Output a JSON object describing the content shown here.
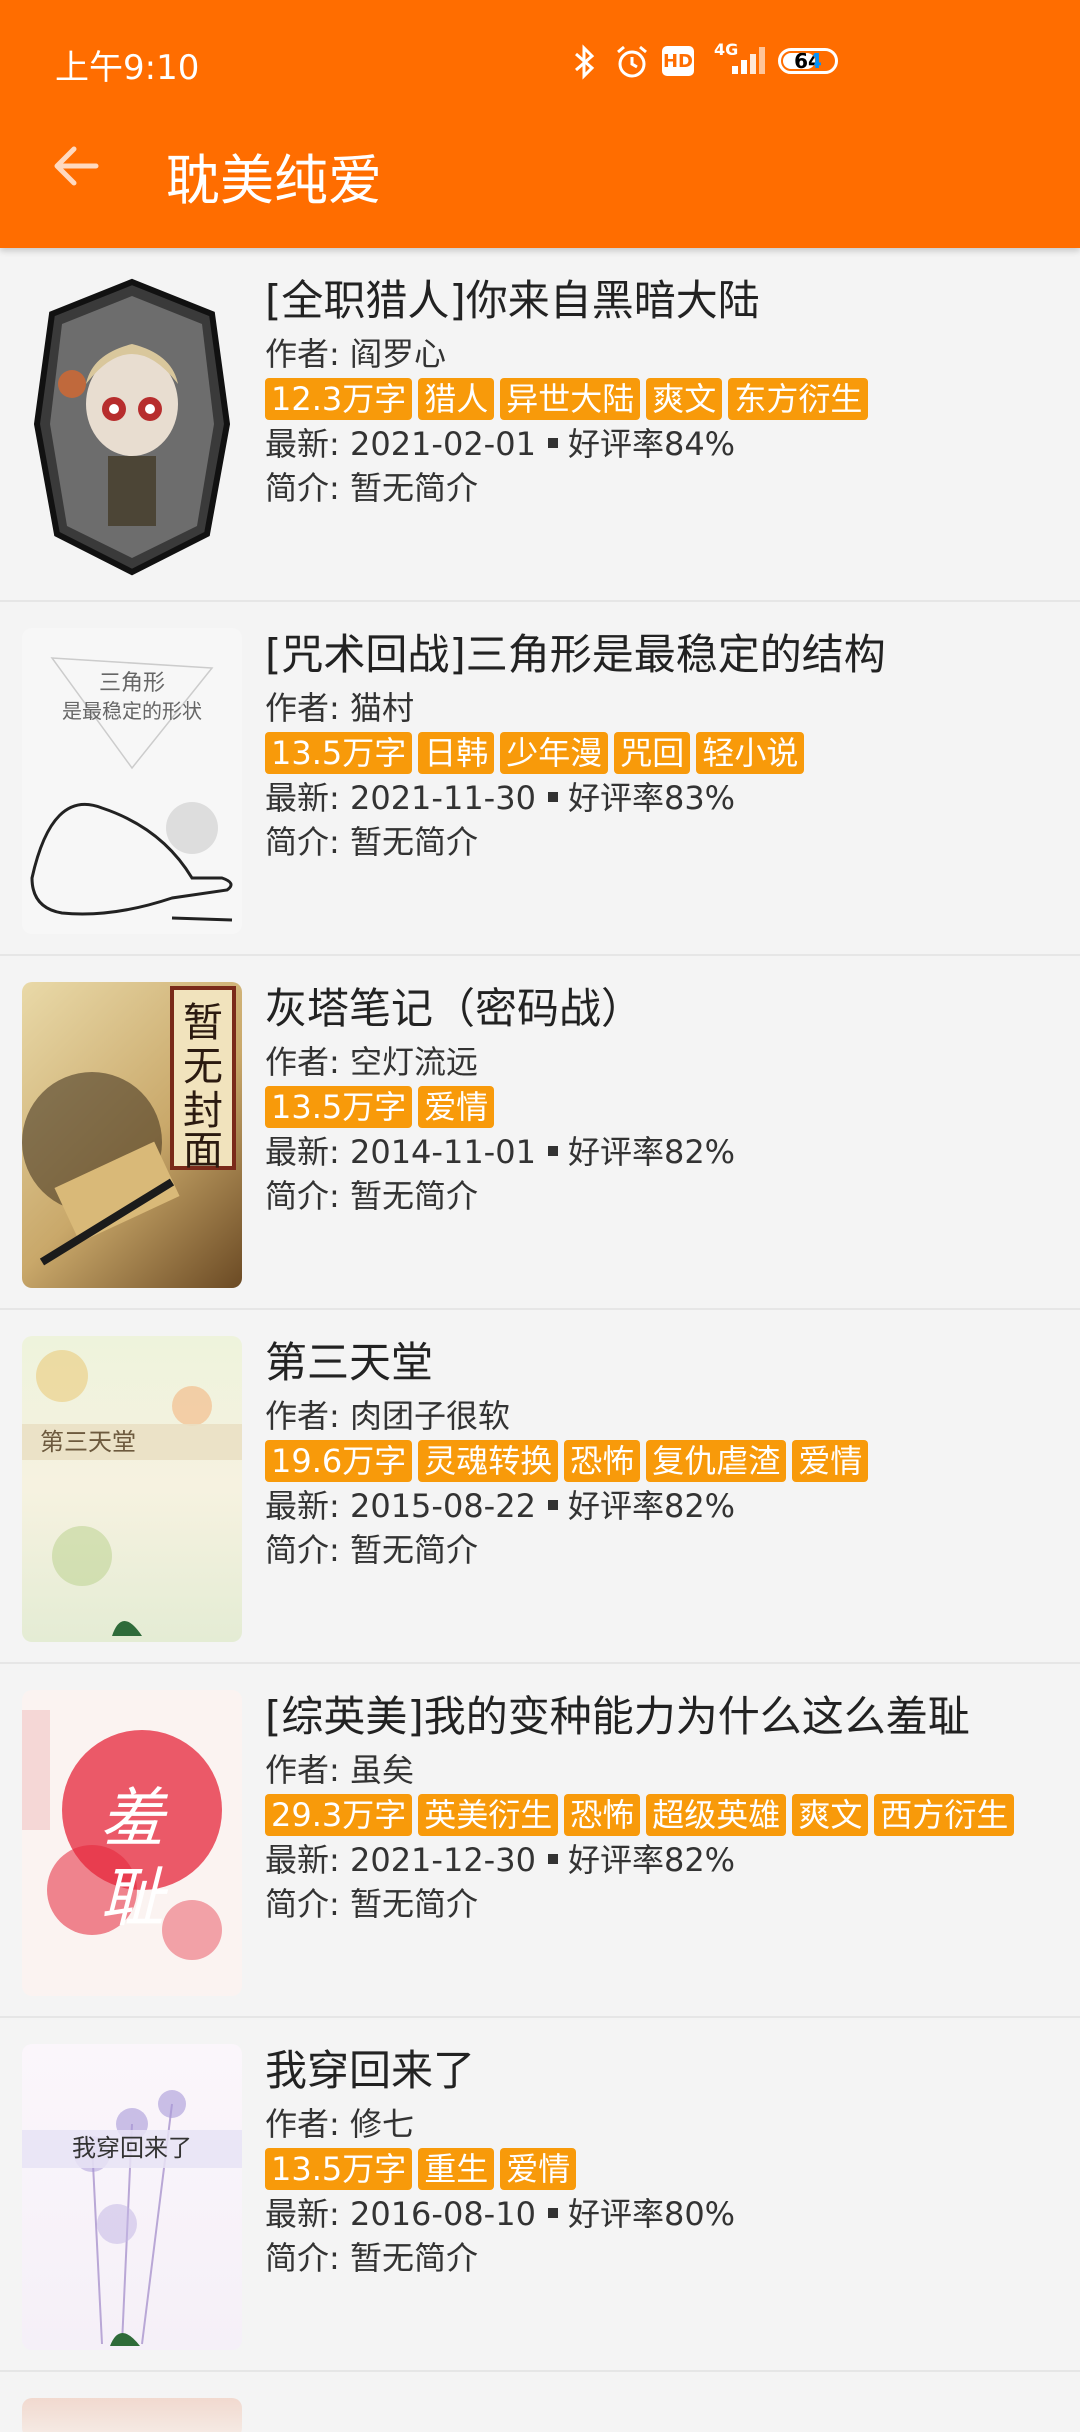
{
  "status_bar": {
    "time": "上午9:10",
    "network": "4G",
    "battery": "64",
    "icons": [
      "bluetooth-icon",
      "alarm-icon",
      "hd-icon",
      "signal-icon",
      "battery-icon"
    ]
  },
  "app_bar": {
    "title": "耽美纯爱",
    "back_icon": "arrow-left-icon",
    "color": "#ff6d00"
  },
  "labels": {
    "author_prefix": "作者: ",
    "latest_prefix": "最新: ",
    "rating_prefix": "好评率",
    "intro_prefix": "简介: "
  },
  "books": [
    {
      "title": "[全职猎人]你来自黑暗大陆",
      "author": "阎罗心",
      "tags": [
        "12.3万字",
        "猎人",
        "异世大陆",
        "爽文",
        "东方衍生"
      ],
      "date": "2021-02-01",
      "rating": "84%",
      "intro": "暂无简介",
      "cover_text": ""
    },
    {
      "title": "[咒术回战]三角形是最稳定的结构",
      "author": "猫村",
      "tags": [
        "13.5万字",
        "日韩",
        "少年漫",
        "咒回",
        "轻小说"
      ],
      "date": "2021-11-30",
      "rating": "83%",
      "intro": "暂无简介",
      "cover_text": "三角形\n是最稳定的形状"
    },
    {
      "title": "灰塔笔记（密码战）",
      "author": "空灯流远",
      "tags": [
        "13.5万字",
        "爱情"
      ],
      "date": "2014-11-01",
      "rating": "82%",
      "intro": "暂无简介",
      "cover_text": "暂无封面"
    },
    {
      "title": "第三天堂",
      "author": "肉团子很软",
      "tags": [
        "19.6万字",
        "灵魂转换",
        "恐怖",
        "复仇虐渣",
        "爱情"
      ],
      "date": "2015-08-22",
      "rating": "82%",
      "intro": "暂无简介",
      "cover_text": "第三天堂"
    },
    {
      "title": "[综英美]我的变种能力为什么这么羞耻",
      "author": "虽矣",
      "tags": [
        "29.3万字",
        "英美衍生",
        "恐怖",
        "超级英雄",
        "爽文",
        "西方衍生"
      ],
      "date": "2021-12-30",
      "rating": "82%",
      "intro": "暂无简介",
      "cover_text": "羞耻"
    },
    {
      "title": "我穿回来了",
      "author": "修七",
      "tags": [
        "13.5万字",
        "重生",
        "爱情"
      ],
      "date": "2016-08-10",
      "rating": "80%",
      "intro": "暂无简介",
      "cover_text": "我穿回来了"
    }
  ]
}
